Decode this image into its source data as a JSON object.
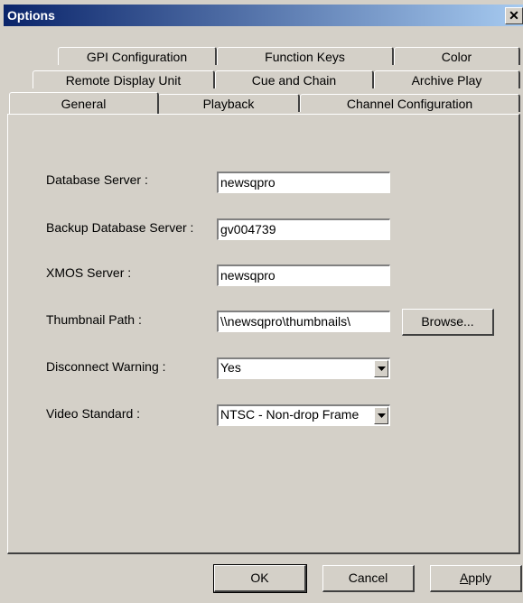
{
  "window": {
    "title": "Options",
    "close_glyph": "✕"
  },
  "tabs": {
    "row1": [
      "GPI Configuration",
      "Function Keys",
      "Color"
    ],
    "row2": [
      "Remote Display Unit",
      "Cue and Chain",
      "Archive Play"
    ],
    "row3": [
      "General",
      "Playback",
      "Channel Configuration"
    ],
    "active": "General"
  },
  "general": {
    "database_server_label": "Database Server :",
    "database_server_value": "newsqpro",
    "backup_db_label": "Backup Database Server :",
    "backup_db_value": "gv004739",
    "xmos_label": "XMOS Server :",
    "xmos_value": "newsqpro",
    "thumbnail_label": "Thumbnail Path :",
    "thumbnail_value": "\\\\newsqpro\\thumbnails\\",
    "browse_label": "Browse...",
    "disconnect_label": "Disconnect Warning :",
    "disconnect_value": "Yes",
    "video_label": "Video Standard :",
    "video_value": "NTSC - Non-drop Frame"
  },
  "buttons": {
    "ok": "OK",
    "cancel": "Cancel",
    "apply_first": "A",
    "apply_rest": "pply"
  },
  "icons": {
    "close": "close-icon",
    "dropdown": "chevron-down-icon"
  },
  "colors": {
    "title_start": "#0a246a",
    "title_end": "#a6caf0",
    "face": "#d4d0c8"
  }
}
